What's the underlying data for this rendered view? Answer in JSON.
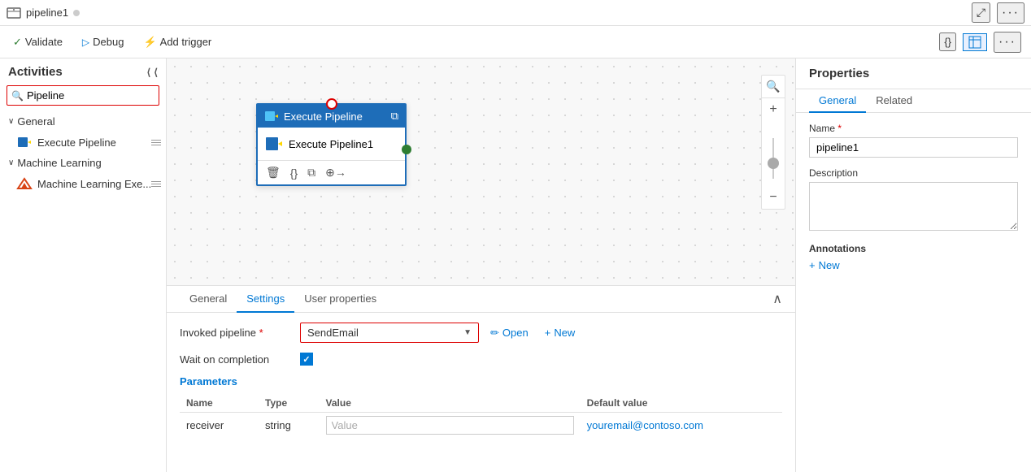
{
  "titleBar": {
    "pipelineName": "pipeline1",
    "dotColor": "#ccc",
    "expandIcon": "⤢",
    "moreIcon": "···"
  },
  "toolbar": {
    "validateLabel": "Validate",
    "debugLabel": "Debug",
    "addTriggerLabel": "Add trigger",
    "codeIcon": "{}",
    "tableIcon": "⊞",
    "moreIcon": "···"
  },
  "sidebar": {
    "title": "Activities",
    "collapseIcon": "⟨⟨",
    "searchPlaceholder": "Pipeline",
    "searchValue": "Pipeline",
    "categories": [
      {
        "name": "General",
        "items": [
          {
            "label": "Execute Pipeline",
            "icon": "execute-pipeline"
          }
        ]
      },
      {
        "name": "Machine Learning",
        "items": [
          {
            "label": "Machine Learning Exe...",
            "icon": "ml-execute"
          }
        ]
      }
    ]
  },
  "canvas": {
    "node": {
      "headerLabel": "Execute Pipeline",
      "bodyLabel": "Execute Pipeline1",
      "openNewTabIcon": "⧉"
    }
  },
  "bottomPanel": {
    "tabs": [
      "General",
      "Settings",
      "User properties"
    ],
    "activeTab": "Settings",
    "fields": {
      "invokedPipelineLabel": "Invoked pipeline",
      "invokedPipelineValue": "SendEmail",
      "openButtonLabel": "Open",
      "newButtonLabel": "New",
      "waitOnCompletionLabel": "Wait on completion"
    },
    "parameters": {
      "title": "Parameters",
      "columns": [
        "Name",
        "Type",
        "Value",
        "Default value"
      ],
      "rows": [
        {
          "name": "receiver",
          "type": "string",
          "valuePlaceholder": "Value",
          "defaultValue": "youremail@contoso.com"
        }
      ]
    }
  },
  "propertiesPanel": {
    "title": "Properties",
    "tabs": [
      "General",
      "Related"
    ],
    "activeTab": "General",
    "fields": {
      "nameLabel": "Name",
      "nameRequired": "*",
      "nameValue": "pipeline1",
      "descriptionLabel": "Description",
      "descriptionValue": ""
    },
    "annotations": {
      "title": "Annotations",
      "newLabel": "New"
    }
  }
}
